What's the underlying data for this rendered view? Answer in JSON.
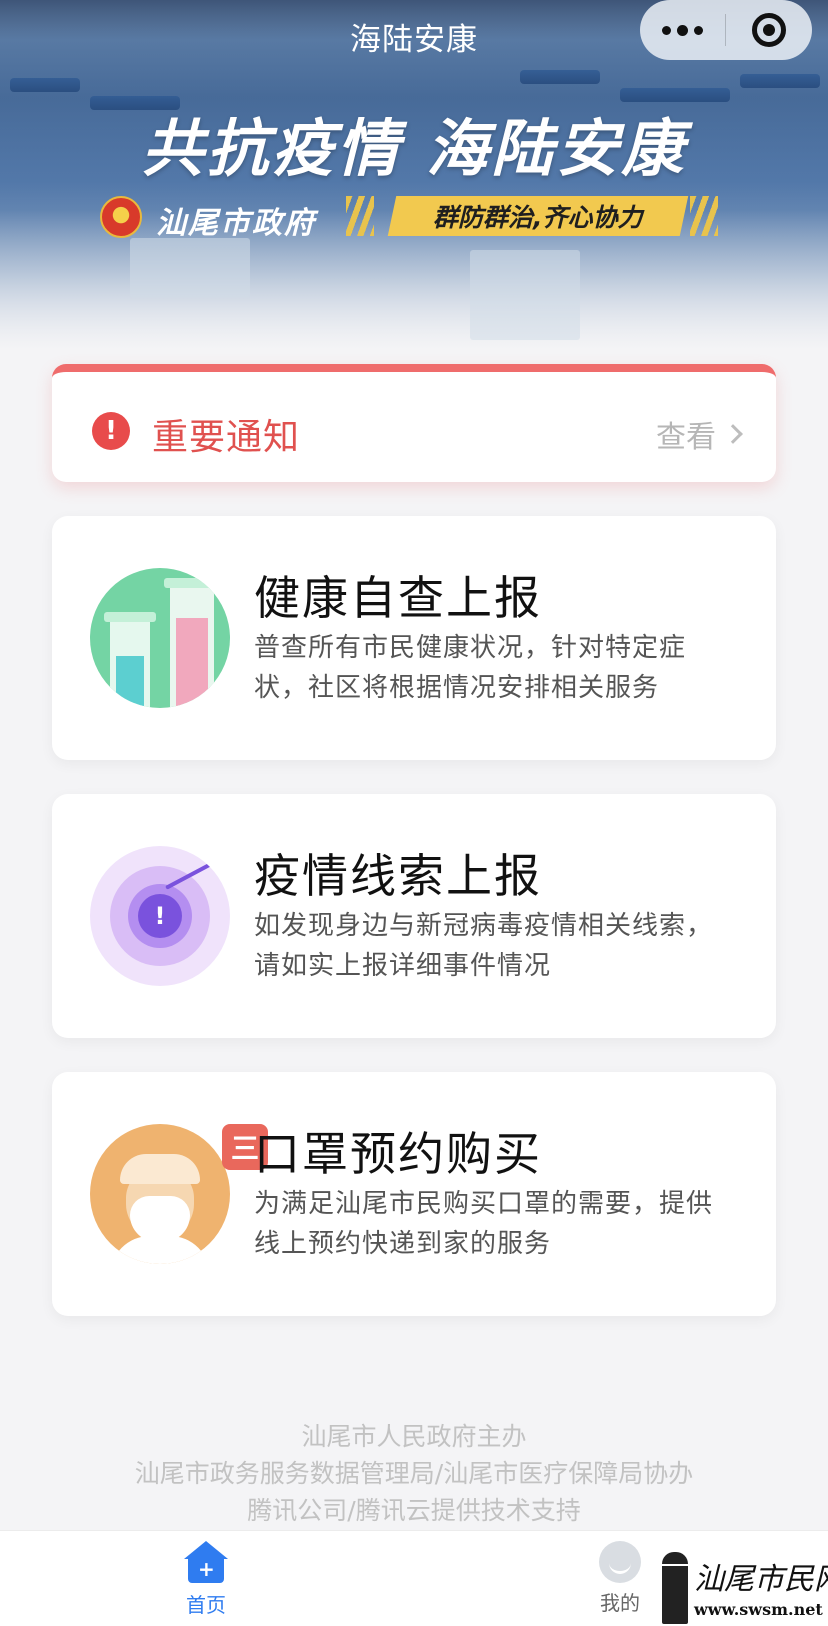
{
  "nav": {
    "title": "海陆安康"
  },
  "hero": {
    "slogan": "共抗疫情 海陆安康",
    "gov_name": "汕尾市政府",
    "motto": "群防群治,齐心协力"
  },
  "notice": {
    "title": "重要通知",
    "view_label": "查看",
    "accent_color": "#e84b4b"
  },
  "cards": [
    {
      "title": "健康自查上报",
      "desc": "普查所有市民健康状况，针对特定症状，社区将根据情况安排相关服务",
      "icon": "test-tubes-icon"
    },
    {
      "title": "疫情线索上报",
      "desc": "如发现身边与新冠病毒疫情相关线索，请如实上报详细事件情况",
      "icon": "radar-alert-icon"
    },
    {
      "title": "口罩预约购买",
      "desc": "为满足汕尾市民购买口罩的需要，提供线上预约快递到家的服务",
      "icon": "masked-doctor-icon",
      "badge": "三"
    }
  ],
  "footer": {
    "line1": "汕尾市人民政府主办",
    "line2": "汕尾市政务服务数据管理局/汕尾市医疗保障局协办",
    "line3": "腾讯公司/腾讯云提供技术支持"
  },
  "tabbar": {
    "home_label": "首页",
    "mine_label": "我的",
    "active_color": "#2f7cf0"
  },
  "watermark": {
    "text": "汕尾市民网",
    "url": "www.swsm.net"
  }
}
